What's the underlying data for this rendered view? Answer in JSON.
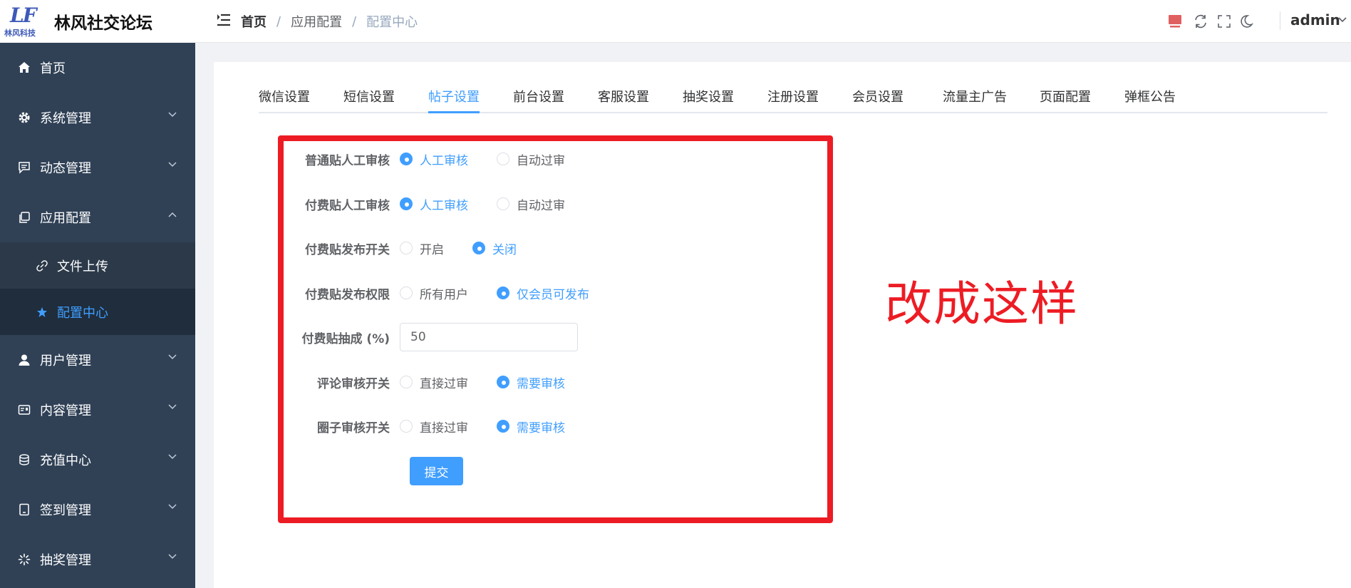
{
  "brand": {
    "logo_text": "LF",
    "logo_sub": "林风科技",
    "title": "林风社交论坛"
  },
  "sidebar": {
    "items": [
      {
        "label": "首页",
        "icon": "home-icon"
      },
      {
        "label": "系统管理",
        "icon": "gear-icon"
      },
      {
        "label": "动态管理",
        "icon": "message-icon"
      },
      {
        "label": "应用配置",
        "icon": "copy-icon",
        "expanded": true,
        "children": [
          {
            "label": "文件上传",
            "icon": "link-icon"
          },
          {
            "label": "配置中心",
            "icon": "star-icon",
            "active": true
          }
        ]
      },
      {
        "label": "用户管理",
        "icon": "user-icon"
      },
      {
        "label": "内容管理",
        "icon": "postcard-icon"
      },
      {
        "label": "充值中心",
        "icon": "coin-icon"
      },
      {
        "label": "签到管理",
        "icon": "tablet-icon"
      },
      {
        "label": "抽奖管理",
        "icon": "loading-icon"
      }
    ]
  },
  "header": {
    "breadcrumb": [
      "首页",
      "应用配置",
      "配置中心"
    ],
    "user": "admin"
  },
  "tabs": {
    "items": [
      "微信设置",
      "短信设置",
      "帖子设置",
      "前台设置",
      "客服设置",
      "抽奖设置",
      "注册设置",
      "会员设置",
      "流量主广告",
      "页面配置",
      "弹框公告"
    ],
    "active": "帖子设置"
  },
  "form": {
    "rows": [
      {
        "label": "普通贴人工审核",
        "options": [
          "人工审核",
          "自动过审"
        ],
        "selected": "人工审核"
      },
      {
        "label": "付费贴人工审核",
        "options": [
          "人工审核",
          "自动过审"
        ],
        "selected": "人工审核"
      },
      {
        "label": "付费贴发布开关",
        "options": [
          "开启",
          "关闭"
        ],
        "selected": "关闭"
      },
      {
        "label": "付费贴发布权限",
        "options": [
          "所有用户",
          "仅会员可发布"
        ],
        "selected": "仅会员可发布"
      },
      {
        "label": "付费贴抽成 (%)",
        "value": "50"
      },
      {
        "label": "评论审核开关",
        "options": [
          "直接过审",
          "需要审核"
        ],
        "selected": "需要审核"
      },
      {
        "label": "圈子审核开关",
        "options": [
          "直接过审",
          "需要审核"
        ],
        "selected": "需要审核"
      }
    ],
    "submit_label": "提交"
  },
  "annotation": {
    "text": "改成这样",
    "color": "#ed1c24"
  },
  "colors": {
    "accent": "#409eff",
    "sidebar_bg": "#304156",
    "annotation_red": "#ed1c24"
  }
}
